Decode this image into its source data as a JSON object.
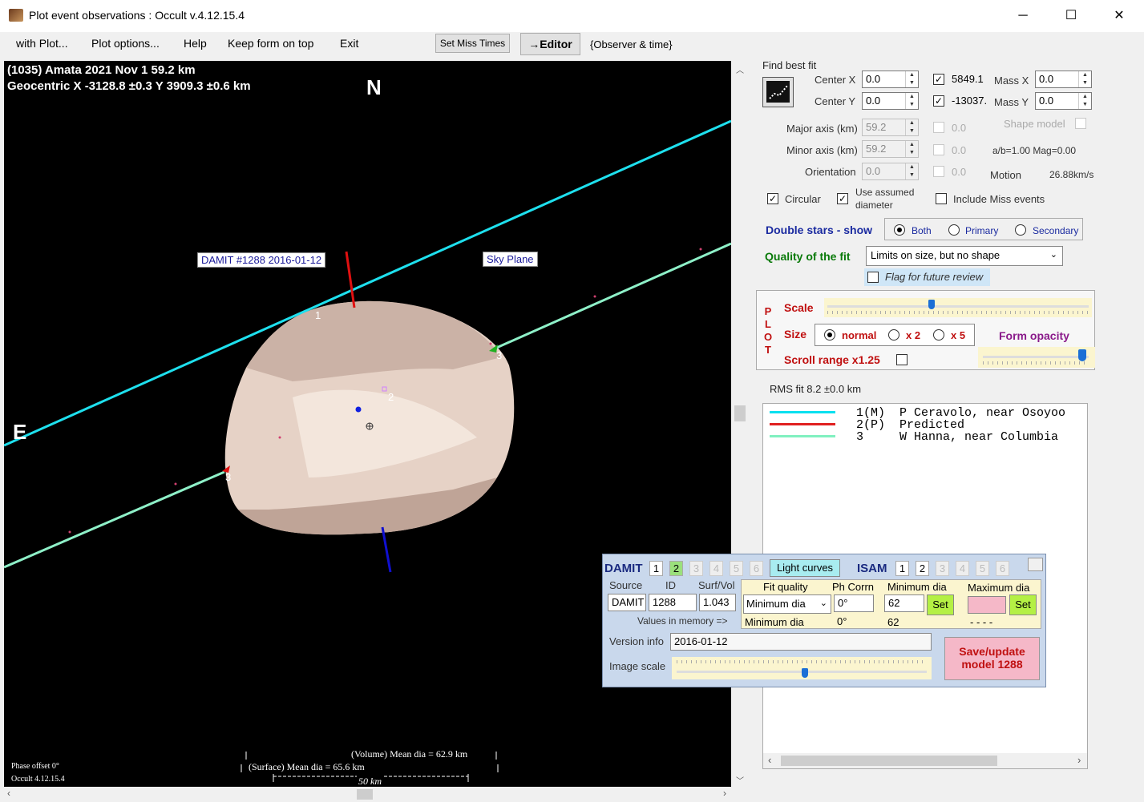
{
  "window": {
    "title": "Plot event observations : Occult v.4.12.15.4",
    "min": "─",
    "max": "☐",
    "close": "✕"
  },
  "menu": {
    "with_plot": "with Plot...",
    "plot_options": "Plot options...",
    "help": "Help",
    "keep_on_top": "Keep form on top",
    "exit": "Exit",
    "set_miss_times": "Set Miss Times",
    "editor": "→Editor",
    "observer_time": "{Observer & time}"
  },
  "plot": {
    "header_line1": "(1035) Amata  2021 Nov 1   59.2 km",
    "header_line2": "Geocentric X  -3128.8 ±0.3  Y 3909.3 ±0.6 km",
    "north": "N",
    "east": "E",
    "damit_label": "DAMIT #1288 2016-01-12",
    "sky_plane": "Sky Plane",
    "chord1": "1",
    "chord2": "2",
    "chord3a": "3",
    "chord3b": "3",
    "volume_dia": "(Volume) Mean dia = 62.9 km",
    "surface_dia": "(Surface) Mean dia = 65.6 km",
    "scale_bar": "50 km",
    "phase_offset": "Phase offset 0°",
    "version": "Occult 4.12.15.4"
  },
  "fit": {
    "find_best_fit": "Find best fit",
    "center_x_label": "Center X",
    "center_x": "0.0",
    "center_y_label": "Center Y",
    "center_y": "0.0",
    "check_x_value": "5849.1",
    "check_y_value": "-13037.",
    "mass_x_label": "Mass X",
    "mass_x": "0.0",
    "mass_y_label": "Mass Y",
    "mass_y": "0.0",
    "major_label": "Major axis (km)",
    "major": "59.2",
    "minor_label": "Minor axis (km)",
    "minor": "59.2",
    "orient_label": "Orientation",
    "orient": "0.0",
    "dis1": "0.0",
    "dis2": "0.0",
    "dis3": "0.0",
    "shape_model": "Shape model",
    "ab_mag": "a/b=1.00  Mag=0.00",
    "motion_label": "Motion",
    "motion": "26.88km/s",
    "circular": "Circular",
    "use_assumed": "Use assumed",
    "diameter": "diameter",
    "include_miss": "Include Miss events",
    "double_stars": "Double stars - show",
    "both": "Both",
    "primary": "Primary",
    "secondary": "Secondary",
    "quality_label": "Quality of the fit",
    "quality_value": "Limits on size, but no shape",
    "flag_review": "Flag for future review"
  },
  "plot_panel": {
    "plot_letters": [
      "P",
      "L",
      "O",
      "T"
    ],
    "scale": "Scale",
    "size": "Size",
    "normal": "normal",
    "x2": "x 2",
    "x5": "x 5",
    "form_opacity": "Form opacity",
    "scroll_range": "Scroll range x1.25"
  },
  "rms": "RMS fit 8.2 ±0.0 km",
  "legend": [
    {
      "text": "1(M)  P Ceravolo, near Osoyoo",
      "color": "#00e0f0"
    },
    {
      "text": "2(P)  Predicted",
      "color": "#e02020"
    },
    {
      "text": "3     W Hanna, near Columbia",
      "color": "#80f0c0"
    }
  ],
  "damit": {
    "title": "DAMIT",
    "tabs": [
      "1",
      "2",
      "3",
      "4",
      "5",
      "6"
    ],
    "light_curves": "Light curves",
    "isam": "ISAM",
    "isam_tabs": [
      "1",
      "2",
      "3",
      "4",
      "5",
      "6"
    ],
    "source_label": "Source",
    "id_label": "ID",
    "surfvol_label": "Surf/Vol",
    "source": "DAMIT",
    "id": "1288",
    "surfvol": "1.043",
    "fit_quality_label": "Fit quality",
    "ph_corr_label": "Ph Corrn",
    "min_dia_label": "Minimum dia",
    "max_dia_label": "Maximum dia",
    "fit_quality": "Minimum dia",
    "ph_corr": "0°",
    "min_dia": "62",
    "set": "Set",
    "values_in_memory": "Values in memory =>",
    "mem_fit": "Minimum dia",
    "mem_ph": "0°",
    "mem_min": "62",
    "mem_max": "- - - -",
    "version_label": "Version info",
    "version": "2016-01-12",
    "image_scale": "Image scale",
    "save": "Save/update",
    "save2": "model 1288"
  }
}
